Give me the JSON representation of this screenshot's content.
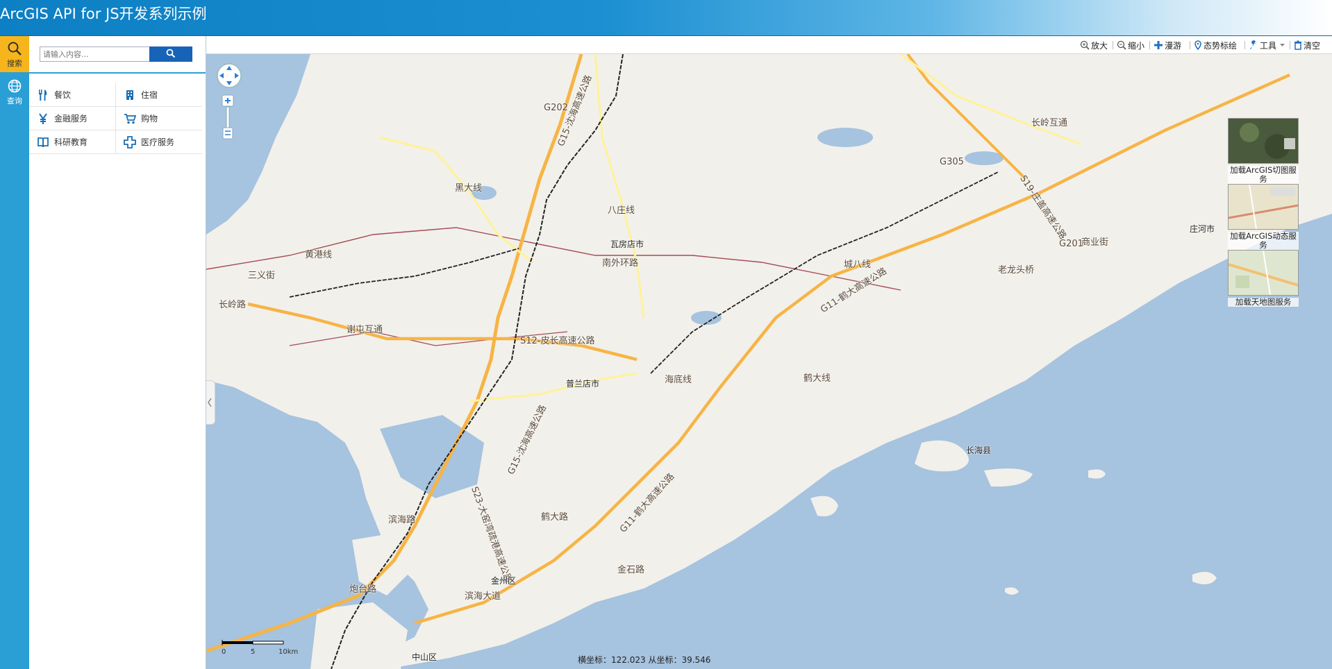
{
  "header": {
    "title": "ArcGIS API for JS开发系列示例"
  },
  "leftbar": {
    "items": [
      {
        "label": "搜索",
        "icon": "search-icon",
        "active": true
      },
      {
        "label": "查询",
        "icon": "globe-icon",
        "active": false
      }
    ]
  },
  "panel": {
    "search": {
      "placeholder": "请输入内容..."
    },
    "categories": [
      {
        "label": "餐饮",
        "icon": "fork-knife-icon"
      },
      {
        "label": "住宿",
        "icon": "hotel-icon"
      },
      {
        "label": "金融服务",
        "icon": "yen-icon"
      },
      {
        "label": "购物",
        "icon": "cart-icon"
      },
      {
        "label": "科研教育",
        "icon": "book-icon"
      },
      {
        "label": "医疗服务",
        "icon": "medical-cross-icon"
      }
    ]
  },
  "toolbar": {
    "items": [
      {
        "label": "放大",
        "icon": "zoom-in-icon"
      },
      {
        "label": "缩小",
        "icon": "zoom-out-icon"
      },
      {
        "label": "漫游",
        "icon": "pan-icon"
      },
      {
        "label": "态势标绘",
        "icon": "pin-icon"
      },
      {
        "label": "工具",
        "icon": "wrench-icon"
      },
      {
        "label": "清空",
        "icon": "trash-icon"
      }
    ]
  },
  "basemaps": [
    {
      "label": "加载ArcGIS切图服务"
    },
    {
      "label": "加载ArcGIS动态服务"
    },
    {
      "label": "加载天地图服务"
    }
  ],
  "map": {
    "labels": [
      "G202",
      "G15-沈海高速公路",
      "黑大线",
      "八庄线",
      "瓦房店市",
      "南外环路",
      "城八线",
      "G305",
      "长岭互通",
      "S19-庄盖高速公路",
      "庄河市",
      "G201",
      "商业街",
      "老龙头桥",
      "G11-鹤大高速公路",
      "S12-皮长高速公路",
      "普兰店市",
      "海底线",
      "鹤大线",
      "长海县",
      "G15-沈海高速公路",
      "S23-大窑湾疏港高速公路",
      "鹤大路",
      "G11-鹤大高速公路",
      "金石路",
      "金州区",
      "滨海大道",
      "中山区",
      "谢屯互通",
      "三义街",
      "长岭路",
      "黄港线",
      "滨海路",
      "炮台路"
    ],
    "scale": {
      "ticks": [
        "0",
        "5",
        "10km"
      ]
    },
    "coords": "横坐标：122.023 从坐标：39.546"
  },
  "colors": {
    "header_blue": "#0d7fc4",
    "leftbar_blue": "#2a9fd6",
    "active_orange": "#f6b51c",
    "search_button": "#1663b7",
    "sea": "#a6c3df",
    "land": "#f2f0ea",
    "highway": "#f7b445",
    "road_yellow": "#fff29a",
    "boundary": "#a34a57"
  }
}
